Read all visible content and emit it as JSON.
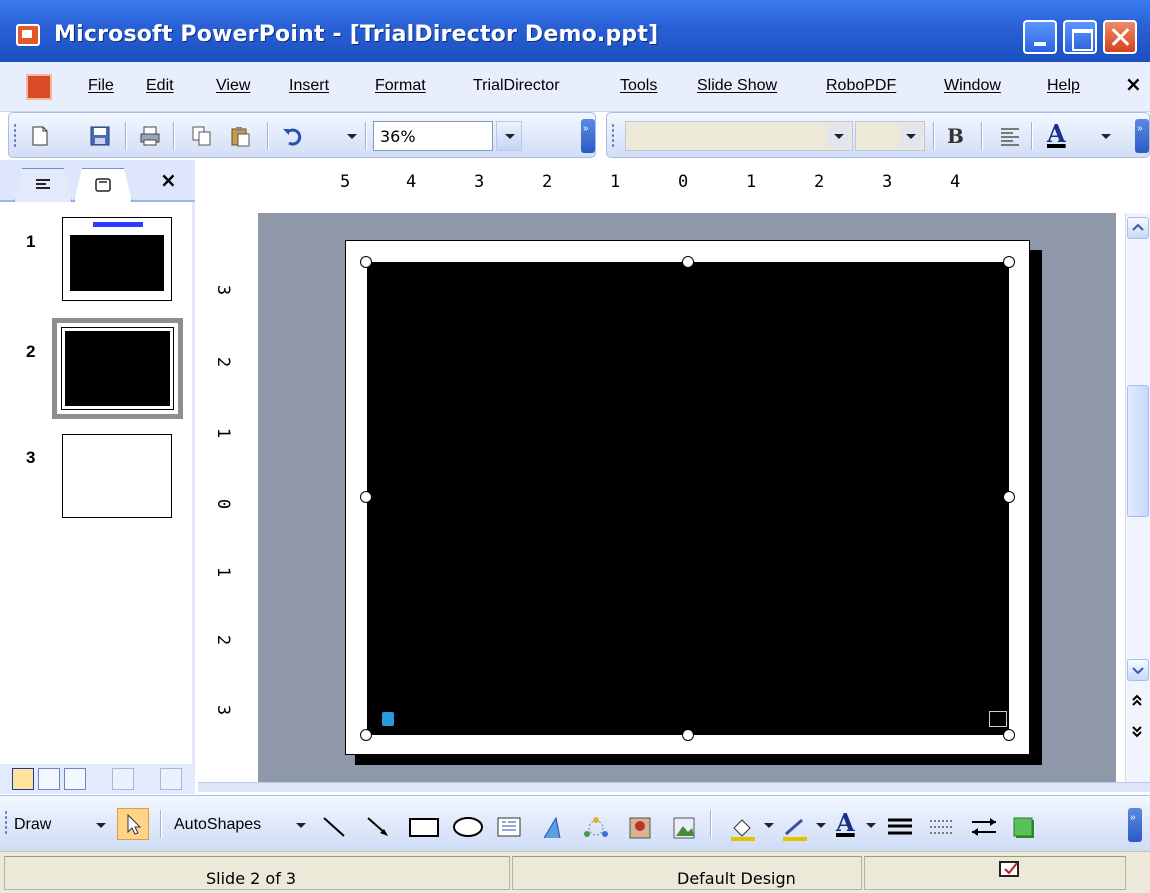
{
  "window": {
    "title": "Microsoft PowerPoint - [TrialDirector Demo.ppt]"
  },
  "menu": {
    "items": [
      "File",
      "Edit",
      "View",
      "Insert",
      "Format",
      "TrialDirector",
      "Tools",
      "Slide Show",
      "RoboPDF",
      "Window",
      "Help"
    ],
    "close_glyph": "×"
  },
  "standard_toolbar": {
    "zoom": "36%",
    "icons": [
      "new-icon",
      "save-icon",
      "print-icon",
      "copy-icon",
      "paste-icon",
      "undo-icon"
    ]
  },
  "formatting_toolbar": {
    "font": "",
    "size": "",
    "bold_label": "B",
    "font_color_label": "A",
    "font_color": "#000000"
  },
  "left_pane": {
    "close_glyph": "×",
    "slides": [
      {
        "number": "1",
        "title_color": "#2a3cff"
      },
      {
        "number": "2",
        "selected": true
      },
      {
        "number": "3"
      }
    ]
  },
  "rulers": {
    "horizontal": [
      "5",
      "4",
      "3",
      "2",
      "1",
      "0",
      "1",
      "2",
      "3",
      "4"
    ],
    "vertical": [
      "3",
      "2",
      "1",
      "0",
      "1",
      "2",
      "3"
    ]
  },
  "slide": {
    "background": "#000000",
    "canvas_color": "#8f98a8"
  },
  "drawing_toolbar": {
    "draw_label": "Draw",
    "autoshapes_label": "AutoShapes",
    "fill_color": "#e0c400",
    "line_color": "#e0c400",
    "font_color_label": "A"
  },
  "status": {
    "slide": "Slide 2 of 3",
    "design": "Default Design"
  }
}
